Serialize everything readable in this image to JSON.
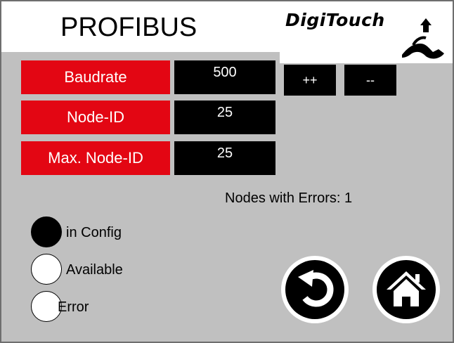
{
  "header": {
    "title": "PROFIBUS",
    "logo_text": "DigiTouch"
  },
  "params": {
    "baudrate": {
      "label": "Baudrate",
      "value": "500"
    },
    "node_id": {
      "label": "Node-ID",
      "value": "25"
    },
    "max_node_id": {
      "label": "Max. Node-ID",
      "value": "25"
    }
  },
  "buttons": {
    "increase_label": "++",
    "decrease_label": "--",
    "back_icon": "undo-arrow-icon",
    "home_icon": "home-icon"
  },
  "status": {
    "nodes_with_errors": "Nodes with Errors: 1"
  },
  "legend": [
    {
      "label": "in Config",
      "state": "filled"
    },
    {
      "label": "Available",
      "state": "empty"
    },
    {
      "label": "Error",
      "state": "empty"
    }
  ],
  "colors": {
    "label_bg": "#e30613",
    "value_bg": "#000000",
    "screen_bg": "#c0c0c0"
  }
}
